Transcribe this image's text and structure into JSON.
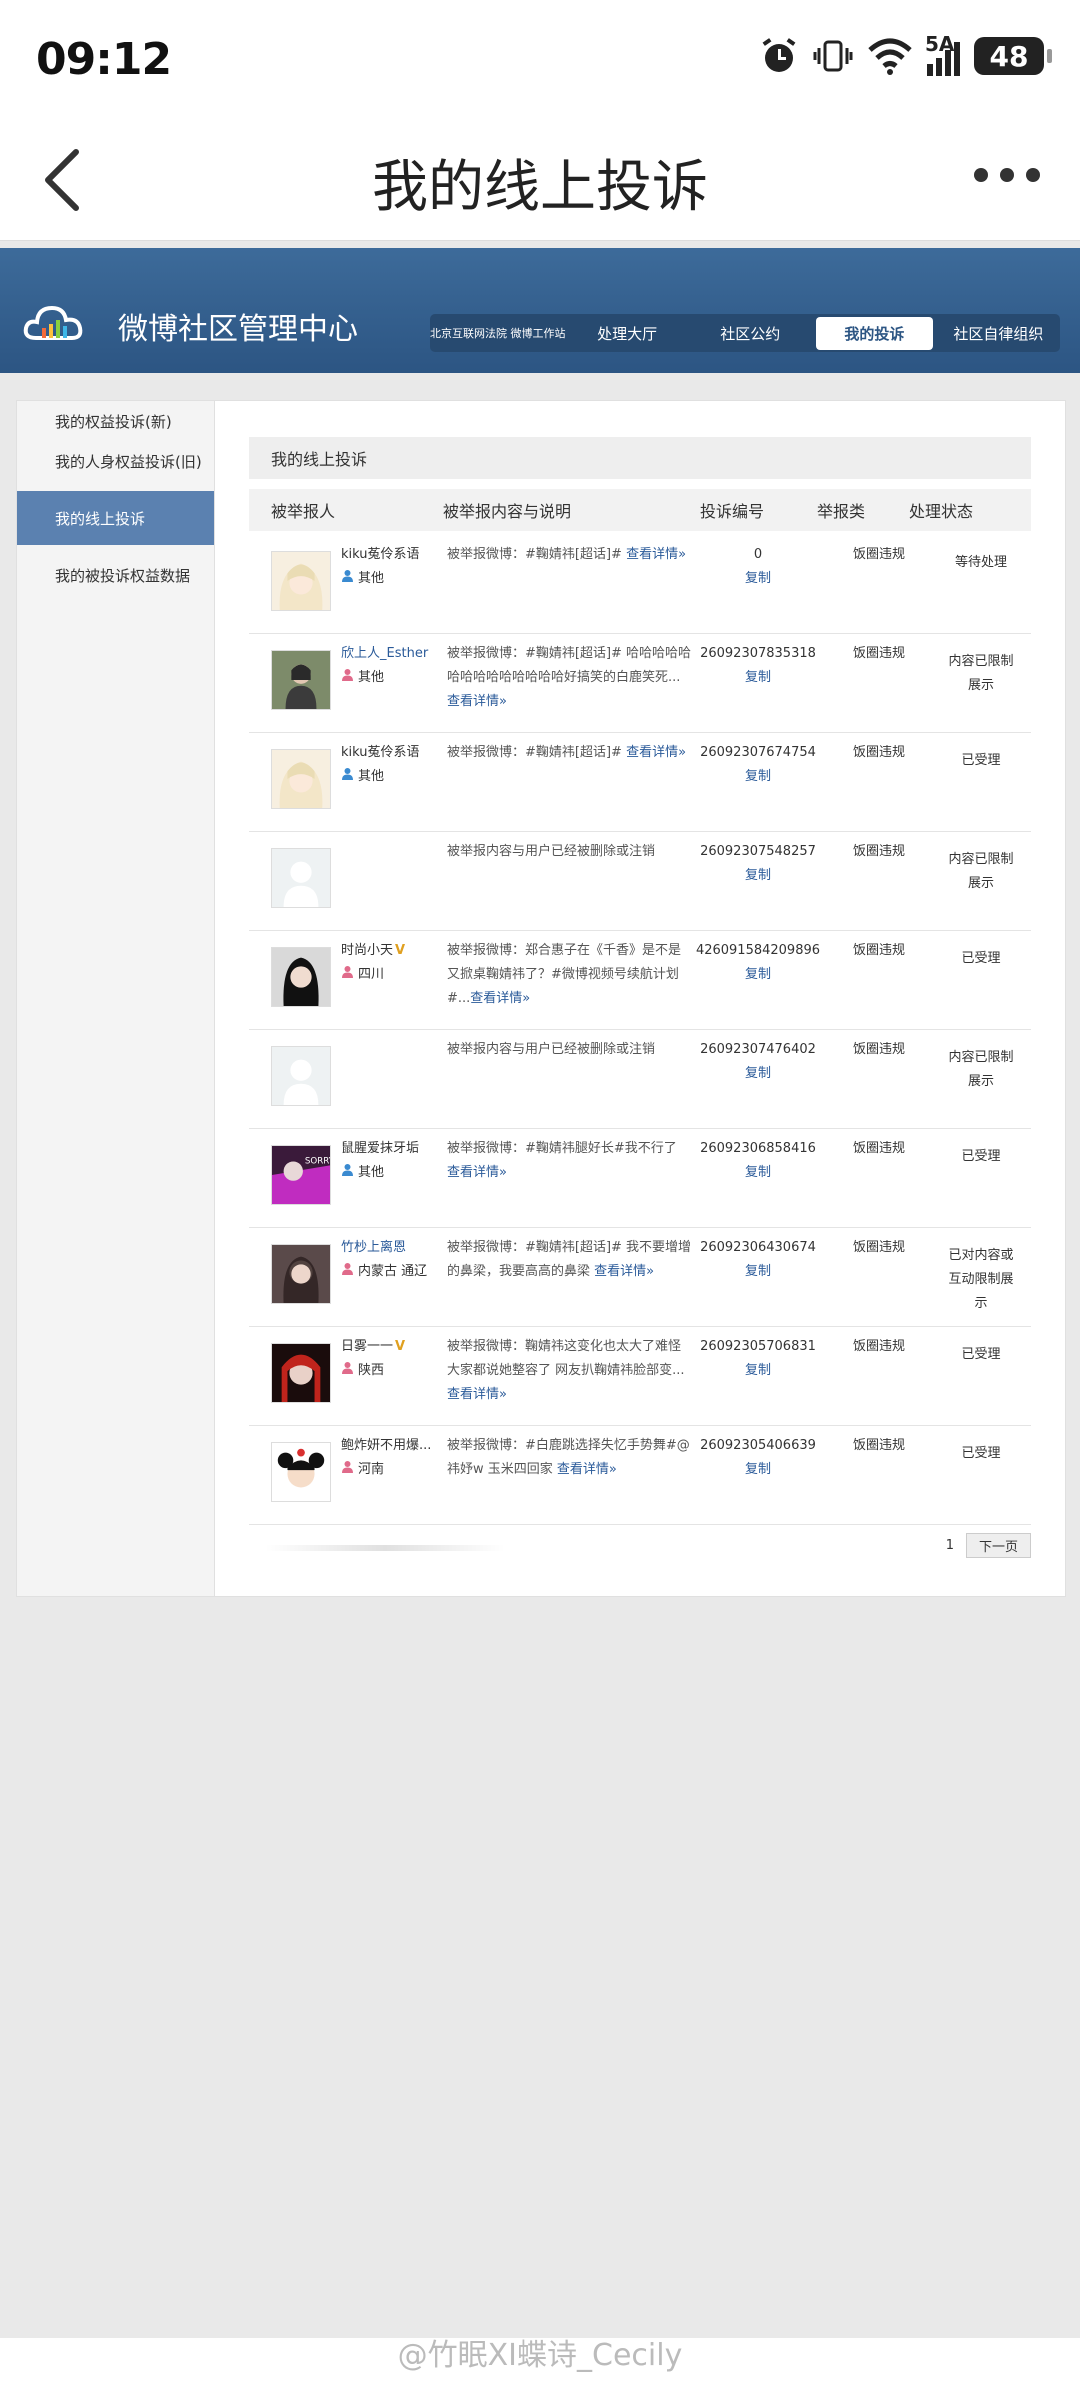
{
  "status": {
    "time": "09:12",
    "battery": "48",
    "network": "5A"
  },
  "nav": {
    "title": "我的线上投诉"
  },
  "site": {
    "name": "微博社区管理中心",
    "nav": [
      {
        "label": "北京互联网法院 微博工作站",
        "small": true
      },
      {
        "label": "处理大厅"
      },
      {
        "label": "社区公约"
      },
      {
        "label": "我的投诉",
        "active": true
      },
      {
        "label": "社区自律组织"
      }
    ]
  },
  "sidebar": {
    "items": [
      {
        "label": "我的权益投诉(新)"
      },
      {
        "label": "我的人身权益投诉(旧)"
      },
      {
        "label": "我的线上投诉",
        "active": true
      },
      {
        "label": "我的被投诉权益数据"
      }
    ]
  },
  "main": {
    "section_title": "我的线上投诉",
    "headers": [
      "被举报人",
      "被举报内容与说明",
      "投诉编号",
      "举报类",
      "处理状态"
    ],
    "rows": [
      {
        "name": "kiku菟伶系语",
        "vip": false,
        "loc": "其他",
        "gender": "m",
        "content_pre": "被举报微博：#鞠婧祎[超话]# ",
        "link": "查看详情»",
        "id": "0",
        "copy": "复制",
        "type": "饭圈违规",
        "status": "等待处理",
        "avatar": "a1"
      },
      {
        "name": "欣上人_Esther",
        "vip": false,
        "loc": "其他",
        "gender": "f",
        "content_pre": "被举报微博：#鞠婧祎[超话]# 哈哈哈哈哈哈哈哈哈哈哈哈哈哈好搞笑的白鹿笑死...",
        "link": "查看详情»",
        "id": "26092307835318",
        "copy": "复制",
        "type": "饭圈违规",
        "status": "内容已限制展示",
        "avatar": "a2"
      },
      {
        "name": "kiku菟伶系语",
        "vip": false,
        "loc": "其他",
        "gender": "m",
        "content_pre": "被举报微博：#鞠婧祎[超话]# ",
        "link": "查看详情»",
        "id": "26092307674754",
        "copy": "复制",
        "type": "饭圈违规",
        "status": "已受理",
        "avatar": "a1"
      },
      {
        "name": "",
        "vip": false,
        "loc": "",
        "gender": "",
        "content_pre": "被举报内容与用户已经被删除或注销",
        "link": "",
        "id": "26092307548257",
        "copy": "复制",
        "type": "饭圈违规",
        "status": "内容已限制展示",
        "avatar": "blank"
      },
      {
        "name": "时尚小天",
        "vip": true,
        "loc": "四川",
        "gender": "f",
        "content_pre": "被举报微博：郑合惠子在《千香》是不是又掀桌鞠婧祎了？#微博视频号续航计划#...",
        "link": "查看详情»",
        "id": "426091584209896",
        "copy": "复制",
        "type": "饭圈违规",
        "status": "已受理",
        "avatar": "a3"
      },
      {
        "name": "",
        "vip": false,
        "loc": "",
        "gender": "",
        "content_pre": "被举报内容与用户已经被删除或注销",
        "link": "",
        "id": "26092307476402",
        "copy": "复制",
        "type": "饭圈违规",
        "status": "内容已限制展示",
        "avatar": "blank"
      },
      {
        "name": "鼠腥爱抹牙垢",
        "vip": false,
        "loc": "其他",
        "gender": "m",
        "content_pre": "被举报微博：#鞠婧祎腿好长#我不行了 ",
        "link": "查看详情»",
        "id": "26092306858416",
        "copy": "复制",
        "type": "饭圈违规",
        "status": "已受理",
        "avatar": "a4"
      },
      {
        "name": "竹杪上离恩",
        "vip": false,
        "loc": "内蒙古 通辽",
        "gender": "f",
        "content_pre": "被举报微博：#鞠婧祎[超话]# 我不要增增的鼻梁，我要高高的鼻梁 ",
        "link": "查看详情»",
        "id": "26092306430674",
        "copy": "复制",
        "type": "饭圈违规",
        "status": "已对内容或互动限制展示",
        "avatar": "a5"
      },
      {
        "name": "日雾一一",
        "vip": true,
        "loc": "陕西",
        "gender": "f",
        "content_pre": "被举报微博：鞠婧祎这变化也太大了难怪大家都说她整容了 网友扒鞠婧祎脸部变...",
        "link": "查看详情»",
        "id": "26092305706831",
        "copy": "复制",
        "type": "饭圈违规",
        "status": "已受理",
        "avatar": "a6"
      },
      {
        "name": "鲍炸妍不用爆...",
        "vip": true,
        "loc": "河南",
        "gender": "f",
        "content_pre": "被举报微博：#白鹿跳选择失忆手势舞#@祎妤w 玉米四回家 ",
        "link": "查看详情»",
        "id": "26092305406639",
        "copy": "复制",
        "type": "饭圈违规",
        "status": "已受理",
        "avatar": "a7"
      }
    ],
    "pager": {
      "page": "1",
      "next": "下一页"
    }
  },
  "watermark": "@竹眠XI蝶诗_Cecily",
  "colors": {
    "header": "#2c5583",
    "active_side": "#5b81b0",
    "link": "#2a5a99"
  }
}
